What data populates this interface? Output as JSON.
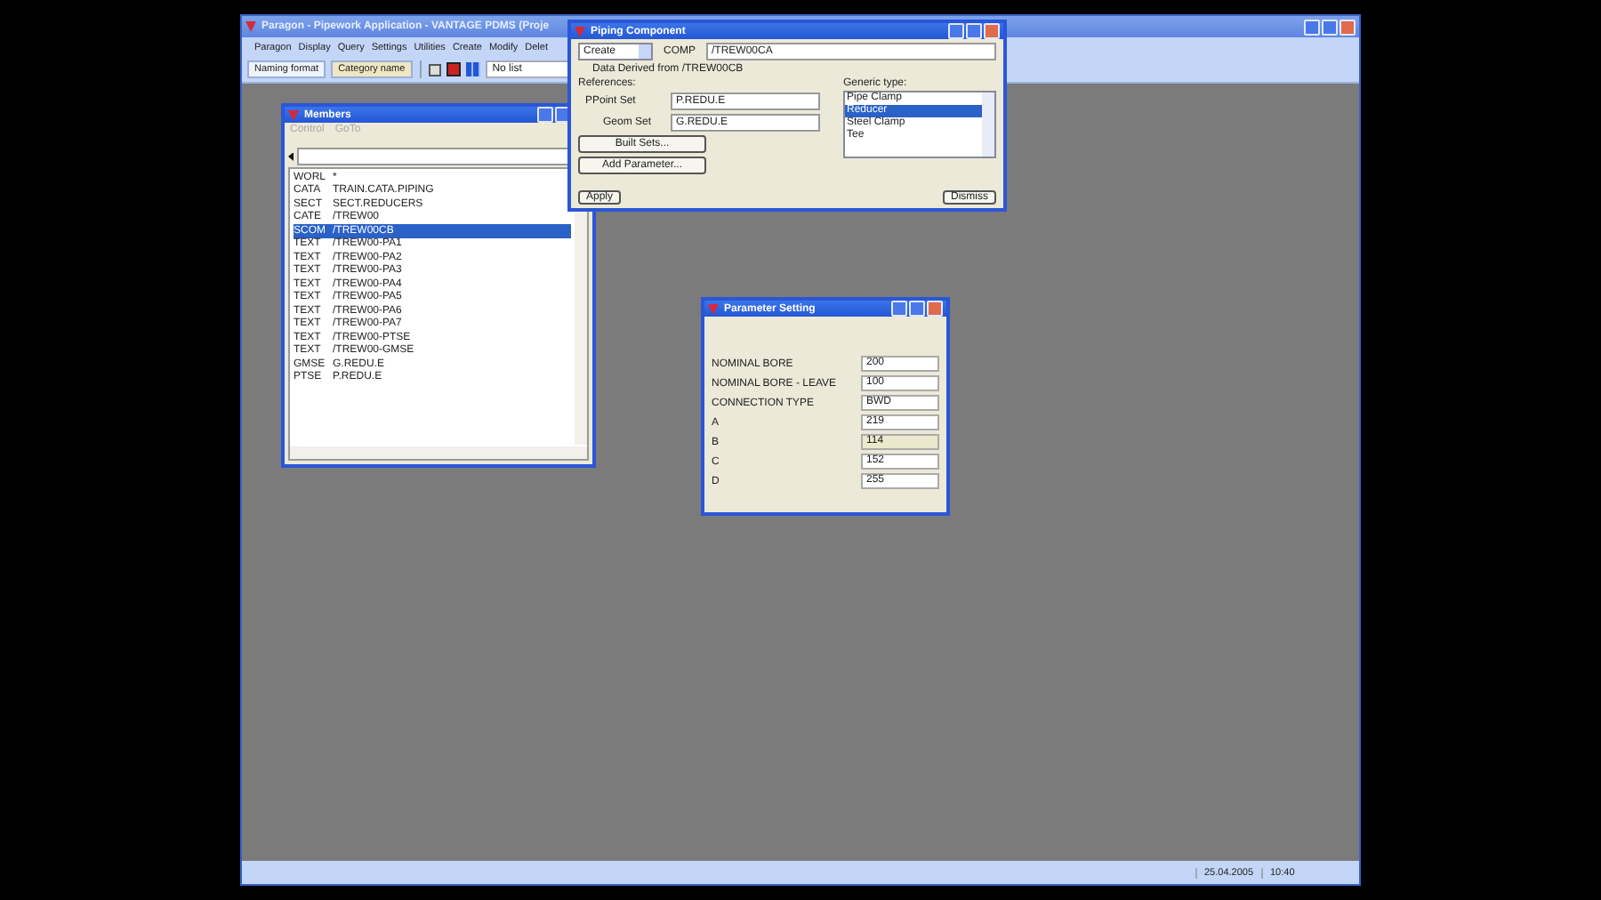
{
  "app": {
    "title": "Paragon - Pipework Application - VANTAGE PDMS (Proje",
    "menu": [
      "Paragon",
      "Display",
      "Query",
      "Settings",
      "Utilities",
      "Create",
      "Modify",
      "Delet"
    ],
    "toolbar": {
      "buttons": [
        {
          "label": "Naming format",
          "selected": false
        },
        {
          "label": "Category name",
          "selected": true
        }
      ],
      "list": "No list"
    },
    "status": [
      "25.04.2005",
      "10:40"
    ]
  },
  "piping": {
    "title": "Piping Component",
    "mode": "Create",
    "type": "COMP",
    "name": "/TREW00CA",
    "derived": "Data Derived from /TREW00CB",
    "references": "References:",
    "sets": [
      {
        "label": "PPoint Set",
        "value": "P.REDU.E"
      },
      {
        "label": "Geom Set",
        "value": "G.REDU.E"
      }
    ],
    "actions": [
      "Built Sets...",
      "Add Parameter..."
    ],
    "generic_label": "Generic type:",
    "generic": [
      {
        "label": "Pipe Clamp",
        "selected": false
      },
      {
        "label": "Reducer",
        "selected": true
      },
      {
        "label": "Steel Clamp",
        "selected": false
      },
      {
        "label": "Tee",
        "selected": false
      }
    ],
    "apply": "Apply",
    "dismiss": "Dismiss"
  },
  "members": {
    "title": "Members",
    "menu": [
      {
        "label": "Control",
        "disabled": true
      },
      {
        "label": "GoTo",
        "disabled": true
      }
    ],
    "rows": [
      {
        "type": "WORL",
        "name": "*",
        "selected": false
      },
      {
        "type": "CATA",
        "name": "TRAIN.CATA.PIPING",
        "selected": false
      },
      {
        "type": "SECT",
        "name": "SECT.REDUCERS",
        "selected": false
      },
      {
        "type": "CATE",
        "name": "/TREW00",
        "selected": false
      },
      {
        "type": "SCOM",
        "name": "/TREW00CB",
        "selected": true
      },
      {
        "type": "TEXT",
        "name": "/TREW00-PA1",
        "selected": false
      },
      {
        "type": "TEXT",
        "name": "/TREW00-PA2",
        "selected": false
      },
      {
        "type": "TEXT",
        "name": "/TREW00-PA3",
        "selected": false
      },
      {
        "type": "TEXT",
        "name": "/TREW00-PA4",
        "selected": false
      },
      {
        "type": "TEXT",
        "name": "/TREW00-PA5",
        "selected": false
      },
      {
        "type": "TEXT",
        "name": "/TREW00-PA6",
        "selected": false
      },
      {
        "type": "TEXT",
        "name": "/TREW00-PA7",
        "selected": false
      },
      {
        "type": "TEXT",
        "name": "/TREW00-PTSE",
        "selected": false
      },
      {
        "type": "TEXT",
        "name": "/TREW00-GMSE",
        "selected": false
      },
      {
        "type": "GMSE",
        "name": "G.REDU.E",
        "selected": false
      },
      {
        "type": "PTSE",
        "name": "P.REDU.E",
        "selected": false
      }
    ]
  },
  "parameters": {
    "title": "Parameter Setting",
    "rows": [
      {
        "label": "NOMINAL BORE",
        "value": "200",
        "disabled": false
      },
      {
        "label": "NOMINAL BORE - LEAVE",
        "value": "100",
        "disabled": false
      },
      {
        "label": "CONNECTION TYPE",
        "value": "BWD",
        "disabled": false
      },
      {
        "label": "A",
        "value": "219",
        "disabled": false
      },
      {
        "label": "B",
        "value": "114",
        "disabled": true
      },
      {
        "label": "C",
        "value": "152",
        "disabled": false
      },
      {
        "label": "D",
        "value": "255",
        "disabled": false
      }
    ]
  }
}
